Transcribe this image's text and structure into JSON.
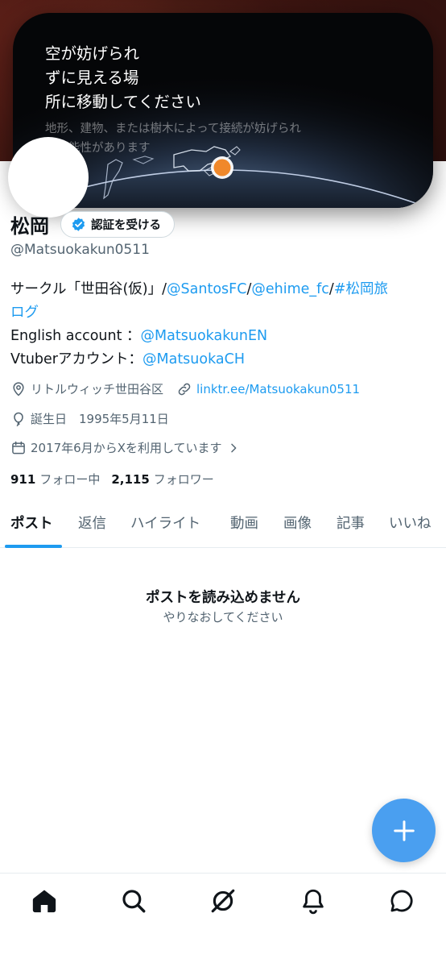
{
  "toast": {
    "title": "空が妨げられ\nずに見える場\n所に移動してください",
    "subtitle": "地形、建物、または樹木によって接続が妨げられる可能性があります"
  },
  "profile": {
    "name": "松岡",
    "verify_label": "認証を受ける",
    "handle": "@Matsuokakun0511",
    "bio": {
      "line1_text": "サークル「世田谷(仮)」/",
      "line1_link1": "@SantosFC",
      "slash1": "/",
      "line1_link2": "@ehime_fc",
      "slash2": "/",
      "line1_link3a": "#松岡旅",
      "line1_link3b": "ログ",
      "line3_text": "English account ：",
      "line3_link": "@MatsuokakunEN",
      "line4_text": "Vtuberアカウント：",
      "line4_link": "@MatsuokaCH"
    },
    "location": "リトルウィッチ世田谷区",
    "website": "linktr.ee/Matsuokakun0511",
    "birthday": "誕生日　1995年5月11日",
    "joined": "2017年6月からXを利用しています",
    "following_count": "911",
    "following_label": "フォロー中",
    "followers_count": "2,115",
    "followers_label": "フォロワー"
  },
  "tabs": [
    {
      "label": "ポスト",
      "active": true
    },
    {
      "label": "返信"
    },
    {
      "label": "ハイライト"
    },
    {
      "label": "動画"
    },
    {
      "label": "画像"
    },
    {
      "label": "記事"
    },
    {
      "label": "いいね"
    }
  ],
  "empty_state": {
    "title": "ポストを読み込めません",
    "subtitle": "やりなおしてください"
  },
  "icons": {
    "location": "map-pin-icon",
    "link": "link-icon",
    "birthday": "balloon-icon",
    "joined": "calendar-icon",
    "fab": "plus-icon",
    "nav": [
      "home-icon",
      "search-icon",
      "grok-icon",
      "bell-icon",
      "message-icon"
    ]
  },
  "colors": {
    "accent": "#1d9bf0",
    "fab": "#4a9ff0",
    "text": "#0f1419",
    "secondary": "#536471",
    "toast_bg": "#050608",
    "location_dot": "#f0882a"
  }
}
